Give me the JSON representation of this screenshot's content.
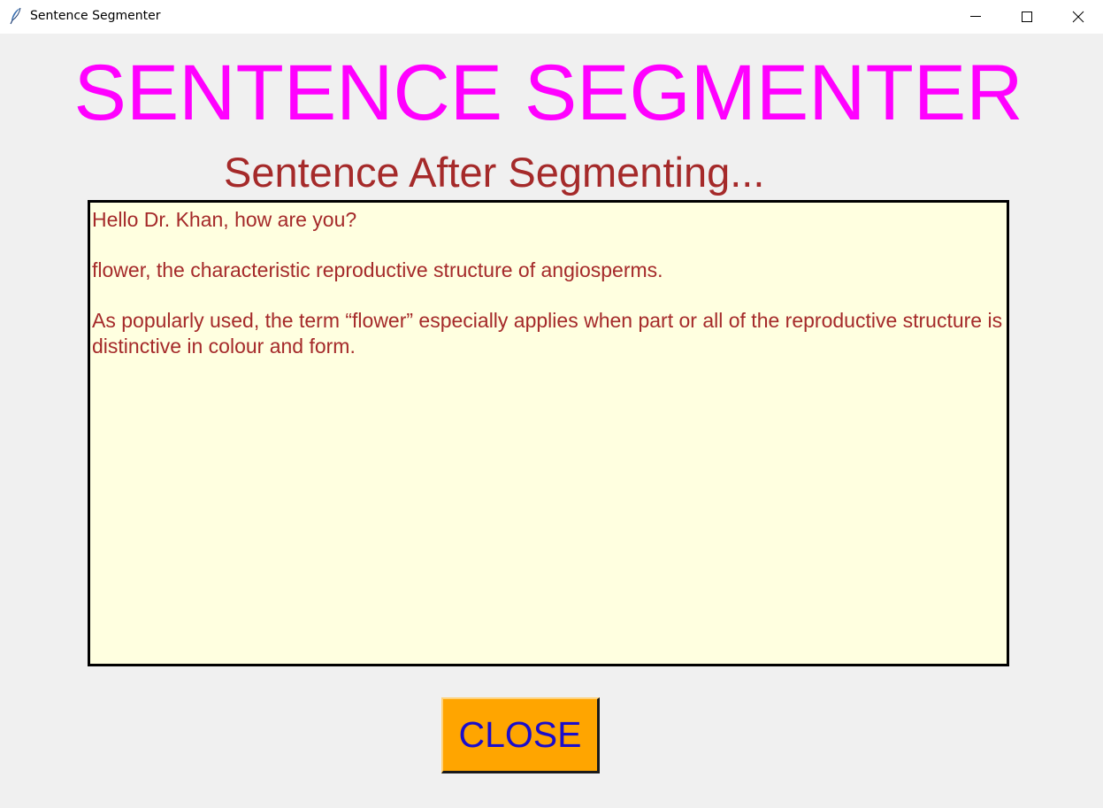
{
  "window": {
    "title": "Sentence Segmenter"
  },
  "icons": {
    "app": "feather-icon",
    "minimize": "minimize-icon",
    "maximize": "maximize-icon",
    "close": "close-icon"
  },
  "main": {
    "heading": "SENTENCE SEGMENTER",
    "subheading": "Sentence After Segmenting...",
    "output_sentences": [
      "Hello Dr. Khan, how are you?",
      "flower, the characteristic reproductive structure of angiosperms.",
      "As popularly used, the term “flower” especially applies when part or all of the reproductive structure is distinctive in colour and form."
    ],
    "close_label": "CLOSE"
  },
  "colors": {
    "heading": "#ff00ff",
    "subheading": "#a52a2a",
    "textbox_background": "#ffffe0",
    "textbox_text": "#a52a2a",
    "button_background": "#ffa500",
    "button_text": "#1a0dcc",
    "window_background": "#f0f0f0"
  }
}
